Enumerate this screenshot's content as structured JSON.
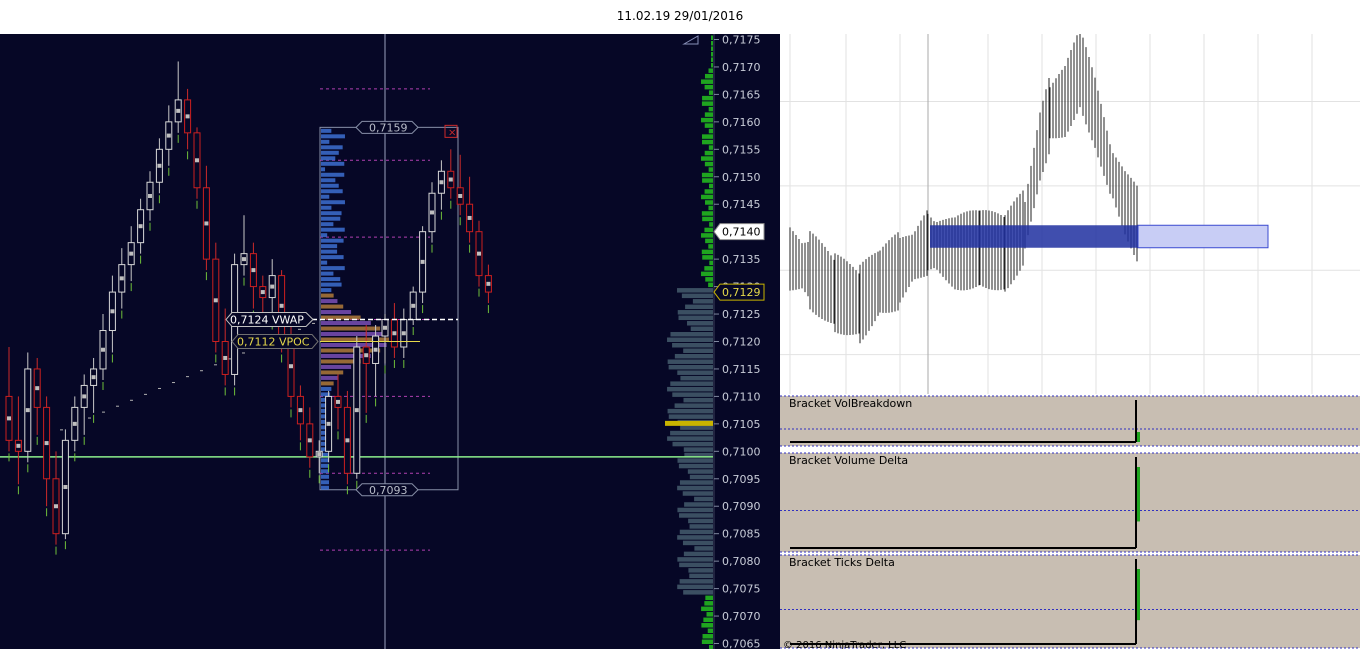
{
  "header": {
    "timestamp": "11.02.19 29/01/2016"
  },
  "colors": {
    "left_bg": "#060726",
    "candle_bear": "#cc1f1f",
    "candle_bull_border": "#d8d8d8",
    "grid_right": "#e0e0e0",
    "indicator_bg": "#c8beb2",
    "green_profile": "#2d8a2d",
    "blue_box": "#c8cdf5",
    "level_line": "#8cf08c"
  },
  "chart_data": [
    {
      "type": "candlestick",
      "name": "main-price-chart",
      "y_axis": {
        "range": [
          0.7064,
          0.7176
        ],
        "ticks": [
          "0,7175",
          "0,7170",
          "0,7165",
          "0,7160",
          "0,7155",
          "0,7150",
          "0,7145",
          "0,7140",
          "0,7135",
          "0,7130",
          "0,7125",
          "0,7120",
          "0,7115",
          "0,7110",
          "0,7105",
          "0,7100",
          "0,7095",
          "0,7090",
          "0,7085",
          "0,7080",
          "0,7075",
          "0,7070",
          "0,7065"
        ]
      },
      "price_markers": [
        {
          "label": "0,7140",
          "value": 0.714,
          "style": "white"
        },
        {
          "label": "0,7129",
          "value": 0.7129,
          "style": "highlight"
        }
      ],
      "range_labels": [
        {
          "label": "0,7159",
          "value": 0.7159
        },
        {
          "label": "0,7093",
          "value": 0.7093
        }
      ],
      "annotations": [
        {
          "label": "0,7124 VWAP",
          "value": 0.7124
        },
        {
          "label": "0,7112 VPOC",
          "value": 0.712
        }
      ],
      "horizontal_level": 0.7099,
      "candles": [
        [
          0.711,
          0.7119,
          0.71,
          0.7102
        ],
        [
          0.7102,
          0.711,
          0.7094,
          0.71
        ],
        [
          0.71,
          0.7118,
          0.7098,
          0.7115
        ],
        [
          0.7115,
          0.7117,
          0.7103,
          0.7108
        ],
        [
          0.7108,
          0.711,
          0.709,
          0.7095
        ],
        [
          0.7095,
          0.71,
          0.7083,
          0.7085
        ],
        [
          0.7085,
          0.7104,
          0.7084,
          0.7102
        ],
        [
          0.7102,
          0.711,
          0.71,
          0.7108
        ],
        [
          0.7108,
          0.7114,
          0.7103,
          0.7112
        ],
        [
          0.7112,
          0.7117,
          0.7107,
          0.7115
        ],
        [
          0.7115,
          0.7125,
          0.7113,
          0.7122
        ],
        [
          0.7122,
          0.7132,
          0.7118,
          0.7129
        ],
        [
          0.7129,
          0.7137,
          0.7126,
          0.7134
        ],
        [
          0.7134,
          0.7141,
          0.7131,
          0.7138
        ],
        [
          0.7138,
          0.7146,
          0.7136,
          0.7144
        ],
        [
          0.7144,
          0.7151,
          0.7142,
          0.7149
        ],
        [
          0.7149,
          0.7157,
          0.7147,
          0.7155
        ],
        [
          0.7155,
          0.7163,
          0.7152,
          0.716
        ],
        [
          0.716,
          0.7171,
          0.7158,
          0.7164
        ],
        [
          0.7164,
          0.7166,
          0.7155,
          0.7158
        ],
        [
          0.7158,
          0.7159,
          0.7146,
          0.7148
        ],
        [
          0.7148,
          0.7152,
          0.7133,
          0.7135
        ],
        [
          0.7135,
          0.7138,
          0.7118,
          0.712
        ],
        [
          0.712,
          0.7126,
          0.7112,
          0.7114
        ],
        [
          0.7114,
          0.7136,
          0.7112,
          0.7134
        ],
        [
          0.7134,
          0.7143,
          0.7132,
          0.7136
        ],
        [
          0.7136,
          0.7138,
          0.7126,
          0.713
        ],
        [
          0.713,
          0.7132,
          0.7125,
          0.7128
        ],
        [
          0.7128,
          0.7135,
          0.7124,
          0.7132
        ],
        [
          0.7132,
          0.7133,
          0.7118,
          0.7121
        ],
        [
          0.7121,
          0.7123,
          0.7108,
          0.711
        ],
        [
          0.711,
          0.7112,
          0.7102,
          0.7105
        ],
        [
          0.7105,
          0.7108,
          0.7097,
          0.7099
        ],
        [
          0.7099,
          0.7102,
          0.7096,
          0.71
        ],
        [
          0.71,
          0.7111,
          0.7098,
          0.711
        ],
        [
          0.711,
          0.7114,
          0.7104,
          0.7108
        ],
        [
          0.7108,
          0.7111,
          0.7094,
          0.7096
        ],
        [
          0.7096,
          0.7121,
          0.7095,
          0.7119
        ],
        [
          0.7119,
          0.7123,
          0.7107,
          0.7116
        ],
        [
          0.7116,
          0.7123,
          0.711,
          0.7121
        ],
        [
          0.7121,
          0.7125,
          0.7116,
          0.7124
        ],
        [
          0.7124,
          0.7127,
          0.7117,
          0.7119
        ],
        [
          0.7119,
          0.7126,
          0.7117,
          0.7124
        ],
        [
          0.7124,
          0.713,
          0.7123,
          0.7129
        ],
        [
          0.7129,
          0.7141,
          0.7127,
          0.714
        ],
        [
          0.714,
          0.7149,
          0.7138,
          0.7147
        ],
        [
          0.7147,
          0.7153,
          0.7144,
          0.7151
        ],
        [
          0.7151,
          0.7155,
          0.7146,
          0.7148
        ],
        [
          0.7148,
          0.7154,
          0.7143,
          0.7145
        ],
        [
          0.7145,
          0.715,
          0.7138,
          0.714
        ],
        [
          0.714,
          0.7142,
          0.713,
          0.7132
        ],
        [
          0.7132,
          0.7134,
          0.7127,
          0.7129
        ]
      ]
    },
    {
      "type": "candlestick",
      "name": "right-price-chart",
      "price_level_box": {
        "from": 0.7134,
        "to": 0.7138
      }
    },
    {
      "type": "bar",
      "name": "indicator-panels",
      "panels": [
        {
          "title": "Bracket VolBreakdown"
        },
        {
          "title": "Bracket Volume Delta"
        },
        {
          "title": "Bracket Ticks Delta"
        }
      ]
    }
  ],
  "footer": {
    "copyright": "© 2016 NinjaTrader, LLC"
  }
}
